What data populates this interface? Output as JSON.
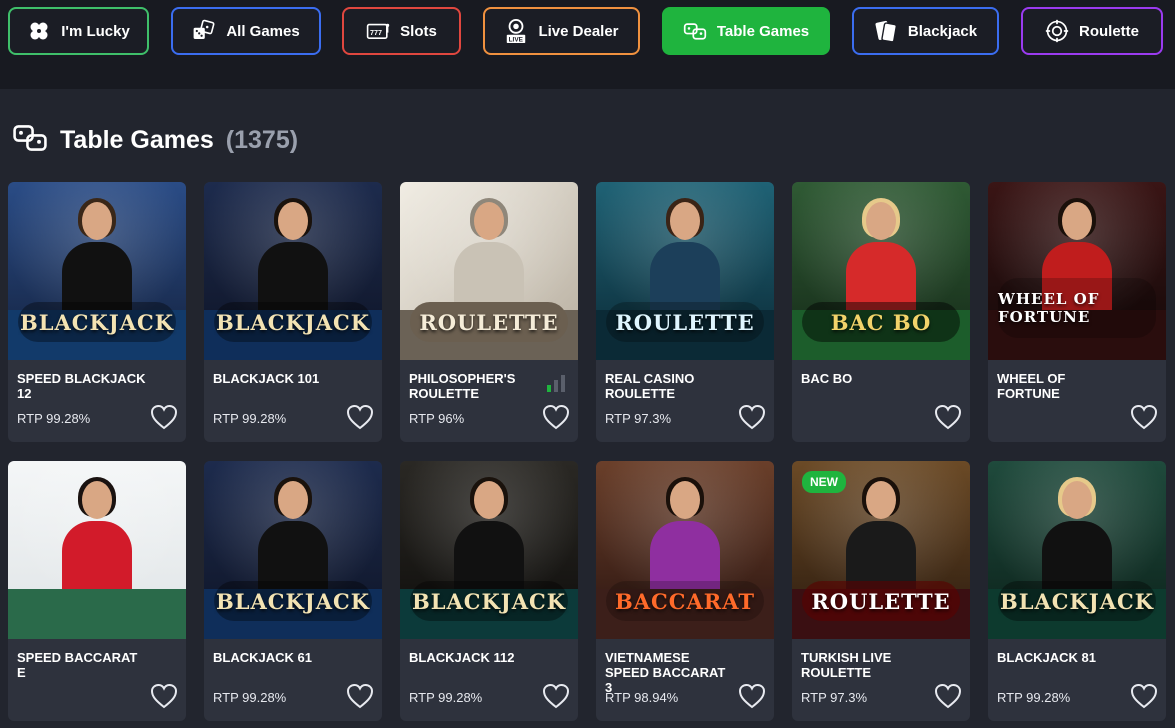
{
  "categories": [
    {
      "label": "I'm Lucky",
      "border": "#3fbf6a",
      "icon": "clover-icon"
    },
    {
      "label": "All Games",
      "border": "#3b6df0",
      "icon": "dice-icon"
    },
    {
      "label": "Slots",
      "border": "#e0473f",
      "icon": "slot-machine-icon"
    },
    {
      "label": "Live Dealer",
      "border": "#f0913f",
      "icon": "live-icon"
    },
    {
      "label": "Table Games",
      "border": "#1fb43e",
      "icon": "gamepad-icon",
      "active": true
    },
    {
      "label": "Blackjack",
      "border": "#3b6df0",
      "icon": "cards-icon"
    },
    {
      "label": "Roulette",
      "border": "#9b3bf0",
      "icon": "roulette-icon"
    }
  ],
  "section": {
    "title": "Table Games",
    "count": "(1375)",
    "icon": "gamepad-icon"
  },
  "games": [
    {
      "name": "SPEED BLACKJACK 12",
      "rtp": "RTP 99.28%",
      "logo": "BLACKJACK",
      "theme": "blue",
      "accent": "#f3e3b3"
    },
    {
      "name": "BLACKJACK 101",
      "rtp": "RTP 99.28%",
      "logo": "BLACKJACK",
      "theme": "navy",
      "accent": "#f3e3b3"
    },
    {
      "name": "PHILOSOPHER'S ROULETTE",
      "rtp": "RTP 96%",
      "logo": "ROULETTE",
      "theme": "stone",
      "accent": "#f5ecd8"
    },
    {
      "name": "REAL CASINO ROULETTE",
      "rtp": "RTP 97.3%",
      "logo": "ROULETTE",
      "theme": "teal",
      "accent": "#dff6ff"
    },
    {
      "name": "BAC BO",
      "rtp": "",
      "logo": "BAC BO",
      "theme": "green",
      "accent": "#f2d36a"
    },
    {
      "name": "WHEEL OF FORTUNE",
      "rtp": "",
      "logo": "WHEEL OF FORTUNE",
      "theme": "red",
      "accent": "#ffffff"
    },
    {
      "name": "SPEED BACCARAT E",
      "rtp": "",
      "logo": "",
      "theme": "white",
      "accent": "#8fb2c9"
    },
    {
      "name": "BLACKJACK 61",
      "rtp": "RTP 99.28%",
      "logo": "BLACKJACK",
      "theme": "navy",
      "accent": "#f3e3b3"
    },
    {
      "name": "BLACKJACK 112",
      "rtp": "RTP 99.28%",
      "logo": "BLACKJACK",
      "theme": "dark",
      "accent": "#f3e3b3"
    },
    {
      "name": "VIETNAMESE SPEED BACCARAT 3",
      "rtp": "RTP 98.94%",
      "logo": "BACCARAT",
      "theme": "purple",
      "accent": "#ff6a2a"
    },
    {
      "name": "TURKISH LIVE ROULETTE",
      "rtp": "RTP 97.3%",
      "logo": "ROULETTE",
      "theme": "gold",
      "accent": "#ffffff",
      "badge": "NEW"
    },
    {
      "name": "BLACKJACK 81",
      "rtp": "RTP 99.28%",
      "logo": "BLACKJACK",
      "theme": "emerald",
      "accent": "#f3e3b3"
    }
  ]
}
